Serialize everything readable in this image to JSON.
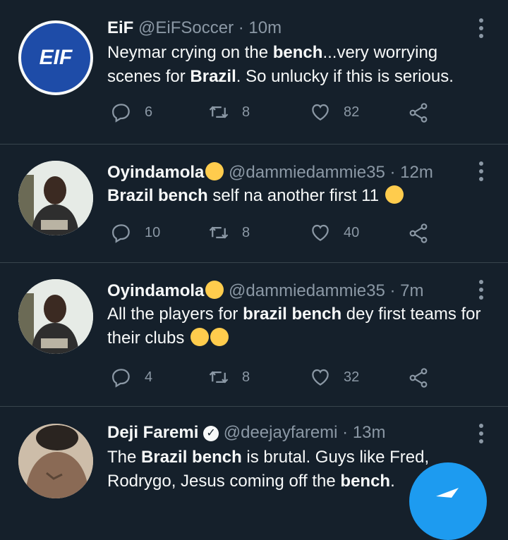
{
  "tweets": [
    {
      "name": "EiF",
      "handle": "@EiFSoccer",
      "time": "· 10m",
      "avatar_text": "EIF",
      "text_parts": [
        "Neymar crying on the ",
        "bench",
        "...very worrying scenes for ",
        "Brazil",
        ". So unlucky if this is serious."
      ],
      "replies": "6",
      "retweets": "8",
      "likes": "82"
    },
    {
      "name": "Oyindamola",
      "handle": "@dammiedammie35",
      "time": "· 12m",
      "text_parts": [
        "Brazil bench",
        " self na another first 11 "
      ],
      "replies": "10",
      "retweets": "8",
      "likes": "40"
    },
    {
      "name": "Oyindamola",
      "handle": "@dammiedammie35",
      "time": "· 7m",
      "text_parts": [
        "All the players for ",
        "brazil bench",
        " dey first teams for their clubs "
      ],
      "replies": "4",
      "retweets": "8",
      "likes": "32"
    },
    {
      "name": "Deji Faremi",
      "handle": "@deejayfaremi",
      "time": "· 13m",
      "text_parts": [
        "The ",
        "Brazil bench",
        " is brutal. Guys like Fred, Rodrygo, Jesus coming off the ",
        "bench",
        "."
      ],
      "replies": "",
      "retweets": "",
      "likes": ""
    }
  ],
  "icons": {
    "reply": "reply-bubble-icon",
    "retweet": "retweet-icon",
    "like": "heart-icon",
    "share": "share-icon",
    "more": "more-options-icon",
    "verified": "verified-badge-icon",
    "compose": "compose-tweet-icon"
  },
  "colors": {
    "background": "#15202b",
    "text": "#f7f9f9",
    "muted": "#8b98a5",
    "accent": "#1d9bf0",
    "divider": "#38444d"
  }
}
